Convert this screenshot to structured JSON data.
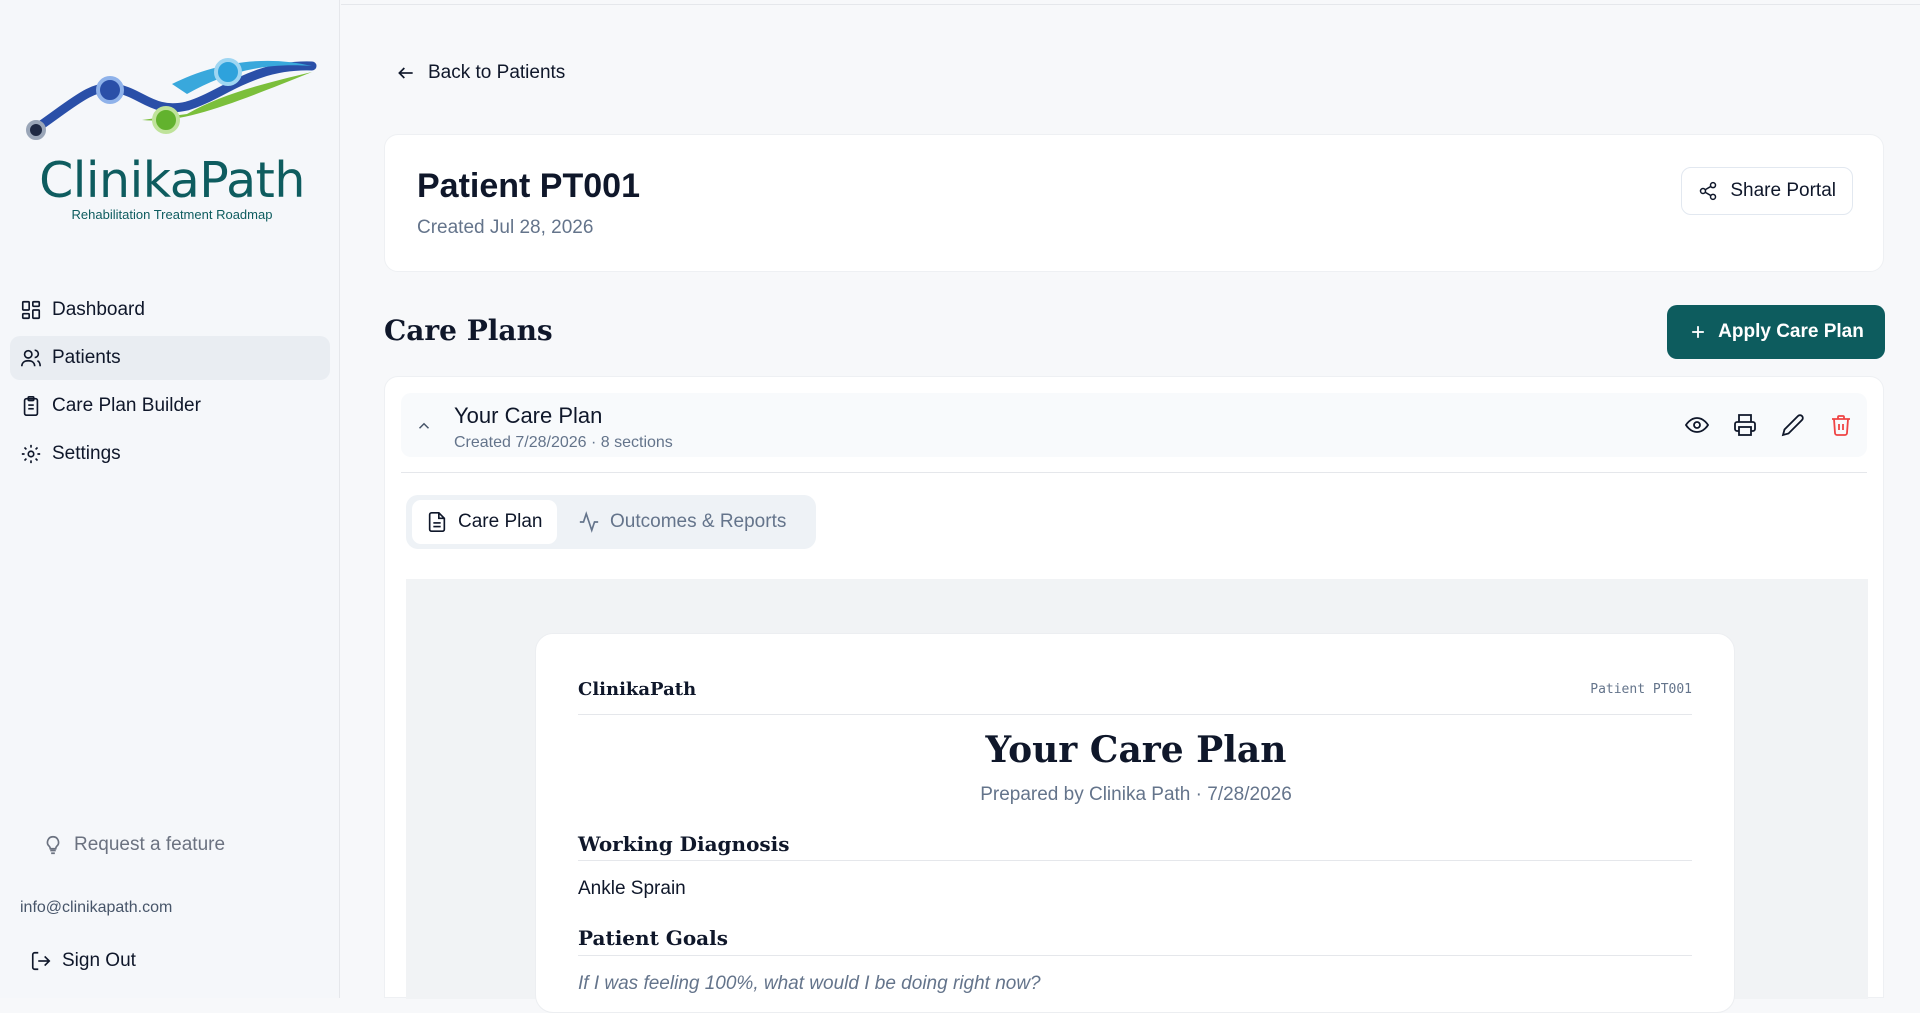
{
  "sidebar": {
    "logo": {
      "name": "ClinikaPath",
      "tagline": "Rehabilitation Treatment Roadmap"
    },
    "nav": [
      {
        "label": "Dashboard",
        "icon": "dashboard-icon",
        "active": false
      },
      {
        "label": "Patients",
        "icon": "users-icon",
        "active": true
      },
      {
        "label": "Care Plan Builder",
        "icon": "clipboard-icon",
        "active": false
      },
      {
        "label": "Settings",
        "icon": "gear-icon",
        "active": false
      }
    ],
    "request_feature": "Request a feature",
    "email": "info@clinikapath.com",
    "sign_out": "Sign Out"
  },
  "main": {
    "back_label": "Back to Patients",
    "patient": {
      "title": "Patient PT001",
      "created": "Created Jul 28, 2026"
    },
    "share_label": "Share Portal",
    "section_title": "Care Plans",
    "apply_label": "Apply Care Plan",
    "plan": {
      "title": "Your Care Plan",
      "subtitle": "Created 7/28/2026 · 8 sections"
    },
    "tabs": [
      {
        "label": "Care Plan",
        "icon": "document-icon",
        "active": true
      },
      {
        "label": "Outcomes & Reports",
        "icon": "activity-icon",
        "active": false
      }
    ],
    "document": {
      "brand": "ClinikaPath",
      "patient_id": "Patient PT001",
      "title": "Your Care Plan",
      "prepared": "Prepared by Clinika Path · 7/28/2026",
      "sections": [
        {
          "heading": "Working Diagnosis",
          "text": "Ankle Sprain"
        },
        {
          "heading": "Patient Goals",
          "text": "If I was feeling 100%, what would I be doing right now?"
        }
      ]
    }
  },
  "colors": {
    "brand_teal": "#0d5c5e",
    "delete_red": "#ef4444",
    "active_nav_bg": "#e9edf2"
  }
}
